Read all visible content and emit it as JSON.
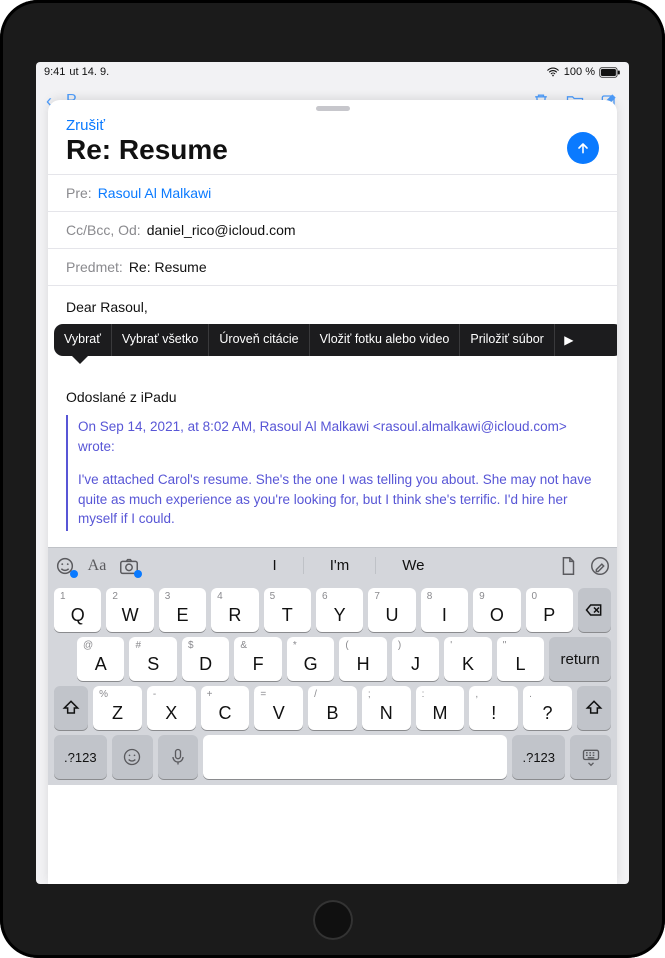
{
  "status": {
    "time": "9:41",
    "date": "ut 14. 9.",
    "battery_text": "100 %",
    "wifi_icon": "wifi",
    "battery_icon": "battery-full"
  },
  "mail_toolbar": {
    "back_label": "P",
    "trash_icon": "trash",
    "folder_icon": "folder",
    "compose_icon": "square-and-pencil"
  },
  "compose": {
    "cancel_label": "Zrušiť",
    "title": "Re: Resume",
    "send_icon": "arrow-up-circle",
    "fields": {
      "to_label": "Pre:",
      "to_value": "Rasoul Al Malkawi",
      "ccbcc_label": "Cc/Bcc, Od:",
      "ccbcc_value": "daniel_rico@icloud.com",
      "subject_label": "Predmet:",
      "subject_value": "Re: Resume"
    },
    "body": {
      "greeting": "Dear Rasoul,",
      "signature": "Odoslané z iPadu"
    },
    "popover": {
      "select": "Vybrať",
      "select_all": "Vybrať všetko",
      "quote_level": "Úroveň citácie",
      "insert_photo": "Vložiť fotku alebo video",
      "attach_file": "Priložiť súbor",
      "more": "▶"
    },
    "quote": {
      "header": "On Sep 14, 2021, at 8:02 AM, Rasoul Al Malkawi <rasoul.almalkawi@icloud.com> wrote:",
      "body": "I've attached Carol's resume. She's the one I was telling you about. She may not have quite as much experience as you're looking for, but I think she's terrific. I'd hire her myself if I could."
    }
  },
  "shortcut_bar": {
    "emoji_globe_icon": "globe-badge",
    "format_icon": "Aa",
    "camera_icon": "camera-badge",
    "predictions": [
      "I",
      "I'm",
      "We"
    ],
    "scan_icon": "doc",
    "markup_icon": "pencil-circle"
  },
  "keyboard": {
    "row1": [
      {
        "main": "Q",
        "alt": "1"
      },
      {
        "main": "W",
        "alt": "2"
      },
      {
        "main": "E",
        "alt": "3"
      },
      {
        "main": "R",
        "alt": "4"
      },
      {
        "main": "T",
        "alt": "5"
      },
      {
        "main": "Y",
        "alt": "6"
      },
      {
        "main": "U",
        "alt": "7"
      },
      {
        "main": "I",
        "alt": "8"
      },
      {
        "main": "O",
        "alt": "9"
      },
      {
        "main": "P",
        "alt": "0"
      }
    ],
    "row2": [
      {
        "main": "A",
        "alt": "@"
      },
      {
        "main": "S",
        "alt": "#"
      },
      {
        "main": "D",
        "alt": "$"
      },
      {
        "main": "F",
        "alt": "&"
      },
      {
        "main": "G",
        "alt": "*"
      },
      {
        "main": "H",
        "alt": "("
      },
      {
        "main": "J",
        "alt": ")"
      },
      {
        "main": "K",
        "alt": "'"
      },
      {
        "main": "L",
        "alt": "\""
      }
    ],
    "row3": [
      {
        "main": "Z",
        "alt": "%"
      },
      {
        "main": "X",
        "alt": "-"
      },
      {
        "main": "C",
        "alt": "+"
      },
      {
        "main": "V",
        "alt": "="
      },
      {
        "main": "B",
        "alt": "/"
      },
      {
        "main": "N",
        "alt": ";"
      },
      {
        "main": "M",
        "alt": ":"
      },
      {
        "main": "!",
        "alt": ","
      },
      {
        "main": "?",
        "alt": "."
      }
    ],
    "backspace": "⌫",
    "return_label": "return",
    "shift": "⇧",
    "numswitch": ".?123",
    "emoji": "😀",
    "mic": "🎤",
    "dismiss": "⌨"
  }
}
